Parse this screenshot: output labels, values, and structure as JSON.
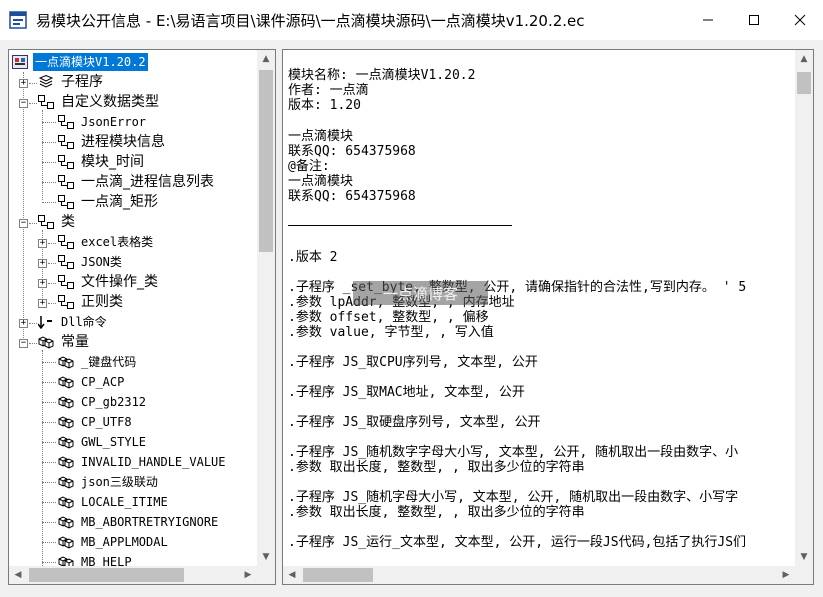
{
  "window": {
    "title": "易模块公开信息 - E:\\易语言项目\\课件源码\\一点滴模块源码\\一点滴模块v1.20.2.ec",
    "minimize_icon": "minimize-icon",
    "maximize_icon": "maximize-icon",
    "close_icon": "close-icon"
  },
  "tree": {
    "root": "一点滴模块V1.20.2",
    "subroutines": "子程序",
    "custom_types": "自定义数据类型",
    "types": [
      "JsonError",
      "进程模块信息",
      "模块_时间",
      "一点滴_进程信息列表",
      "一点滴_矩形"
    ],
    "classes_label": "类",
    "classes": [
      "excel表格类",
      "JSON类",
      "文件操作_类",
      "正则类"
    ],
    "dll": "Dll命令",
    "constants_label": "常量",
    "constants": [
      "_键盘代码",
      "CP_ACP",
      "CP_gb2312",
      "CP_UTF8",
      "GWL_STYLE",
      "INVALID_HANDLE_VALUE",
      "json三级联动",
      "LOCALE_ITIME",
      "MB_ABORTRETRYIGNORE",
      "MB_APPLMODAL",
      "MB_HELP"
    ]
  },
  "content": {
    "lines": [
      "模块名称: 一点滴模块V1.20.2",
      "作者: 一点滴",
      "版本: 1.20",
      "一点滴模块",
      "联系QQ: 654375968",
      "@备注:",
      "一点滴模块",
      "联系QQ: 654375968",
      ".版本 2",
      ".子程序 _set_byte, 整数型, 公开, 请确保指针的合法性,写到内存。 ' 5",
      ".参数 lpAddr, 整数型, , 内存地址",
      ".参数 offset, 整数型, , 偏移",
      ".参数 value, 字节型, , 写入值",
      ".子程序 JS_取CPU序列号, 文本型, 公开",
      ".子程序 JS_取MAC地址, 文本型, 公开",
      ".子程序 JS_取硬盘序列号, 文本型, 公开",
      ".子程序 JS_随机数字字母大小写, 文本型, 公开, 随机取出一段由数字、小",
      ".参数 取出长度, 整数型, , 取出多少位的字符串",
      ".子程序 JS_随机字母大小写, 文本型, 公开, 随机取出一段由数字、小写字",
      ".参数 取出长度, 整数型, , 取出多少位的字符串",
      ".子程序 JS_运行_文本型, 文本型, 公开, 运行一段JS代码,包括了执行JS们"
    ],
    "watermark": "一点滴博客"
  }
}
